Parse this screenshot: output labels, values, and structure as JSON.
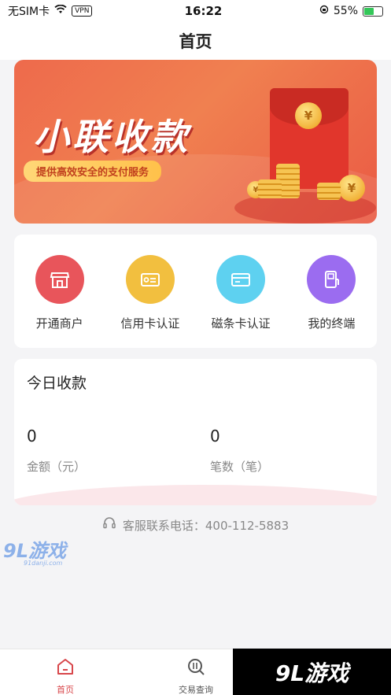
{
  "status_bar": {
    "carrier": "无SIM卡",
    "vpn": "VPN",
    "time": "16:22",
    "battery": "55%",
    "battery_level": 0.55
  },
  "nav": {
    "title": "首页"
  },
  "banner": {
    "title": "小联收款",
    "subtitle": "提供高效安全的支付服务",
    "coin_symbol": "¥"
  },
  "menu": {
    "items": [
      {
        "label": "开通商户",
        "icon": "shop-icon",
        "color": "#e8555b"
      },
      {
        "label": "信用卡认证",
        "icon": "credit-card-icon",
        "color": "#f2bf3f"
      },
      {
        "label": "磁条卡认证",
        "icon": "magstripe-card-icon",
        "color": "#5ed1f0"
      },
      {
        "label": "我的终端",
        "icon": "pos-terminal-icon",
        "color": "#9b6cf0"
      }
    ]
  },
  "today": {
    "title": "今日收款",
    "amount_value": "0",
    "amount_label": "金额（元）",
    "count_value": "0",
    "count_label": "笔数（笔）"
  },
  "service": {
    "text": "客服联系电话：400-112-5883",
    "icon": "headset-icon"
  },
  "tabs": [
    {
      "label": "首页",
      "icon": "home-icon",
      "active": true
    },
    {
      "label": "交易查询",
      "icon": "transaction-search-icon",
      "active": false
    }
  ],
  "watermark": {
    "text": "9L游戏",
    "domain": "91danji.com"
  },
  "colors": {
    "accent": "#d8464a",
    "banner": "#ee6a4c"
  }
}
